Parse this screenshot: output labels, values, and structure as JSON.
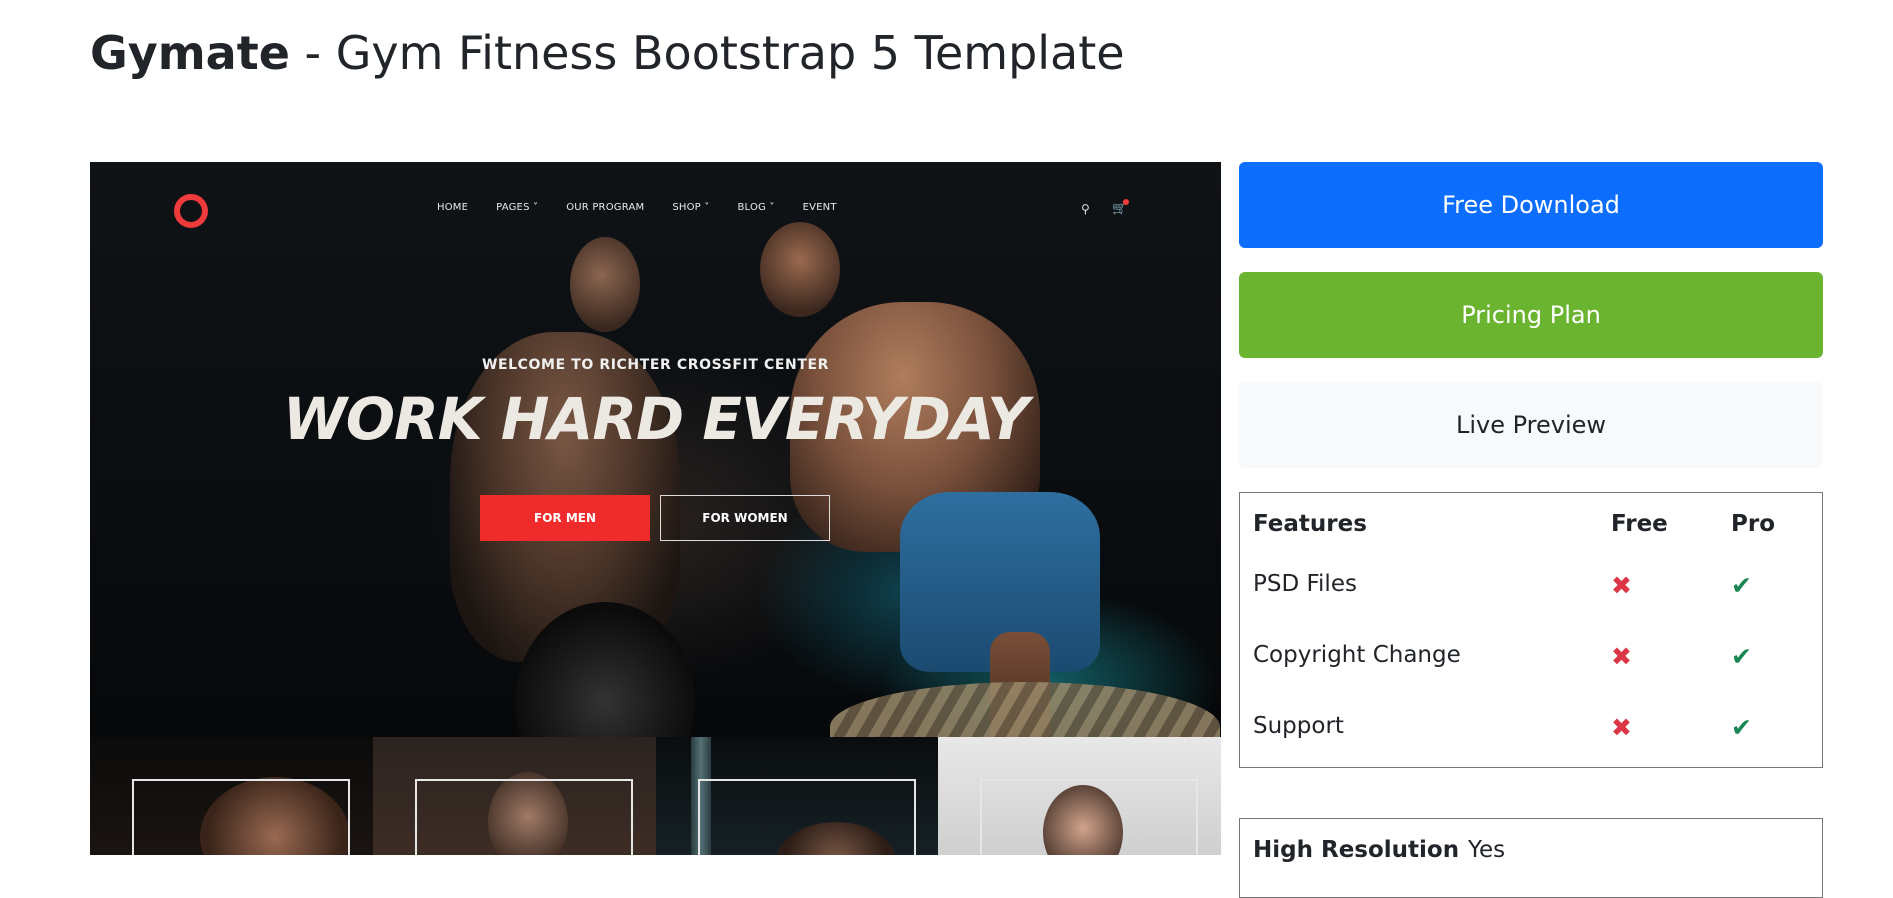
{
  "title": {
    "brand": "Gymate",
    "rest": " - Gym Fitness Bootstrap 5 Template"
  },
  "preview": {
    "nav": [
      "HOME",
      "PAGES ˅",
      "OUR PROGRAM",
      "SHOP ˅",
      "BLOG ˅",
      "EVENT"
    ],
    "welcome": "WELCOME TO RICHTER CROSSFIT CENTER",
    "headline": "WORK HARD EVERYDAY",
    "btn_men": "FOR MEN",
    "btn_women": "FOR WOMEN"
  },
  "actions": {
    "free_download": "Free Download",
    "pricing_plan": "Pricing Plan",
    "live_preview": "Live Preview"
  },
  "features_table": {
    "headers": [
      "Features",
      "Free",
      "Pro"
    ],
    "rows": [
      {
        "feature": "PSD Files",
        "free": "✖",
        "pro": "✔"
      },
      {
        "feature": "Copyright Change",
        "free": "✖",
        "pro": "✔"
      },
      {
        "feature": "Support",
        "free": "✖",
        "pro": "✔"
      }
    ]
  },
  "specs": {
    "high_resolution_label": "High Resolution",
    "high_resolution_value": "Yes"
  },
  "colors": {
    "download": "#0d6efd",
    "pricing": "#6ab42f",
    "preview_bg": "#f8f9fa",
    "cross": "#dc3545",
    "check": "#198754"
  }
}
